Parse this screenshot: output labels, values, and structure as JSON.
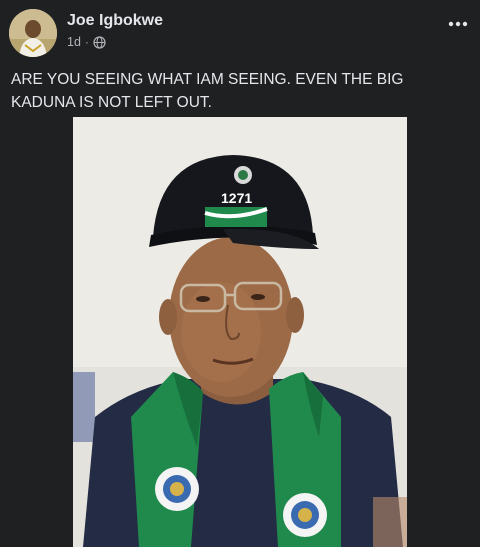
{
  "post": {
    "author": "Joe Igbokwe",
    "time": "1d",
    "separator": "·",
    "audience_icon": "globe-icon",
    "more_icon": "more-options-icon",
    "text": "ARE YOU SEEING WHAT IAM SEEING. EVEN THE BIG KADUNA IS NOT LEFT OUT.",
    "photo": {
      "cap_text": "1271"
    }
  },
  "colors": {
    "background": "#1f2022",
    "text_primary": "#e4e6eb",
    "text_secondary": "#b0b3b8",
    "scarf_green": "#1f8a4c",
    "cap": "#15171c"
  }
}
